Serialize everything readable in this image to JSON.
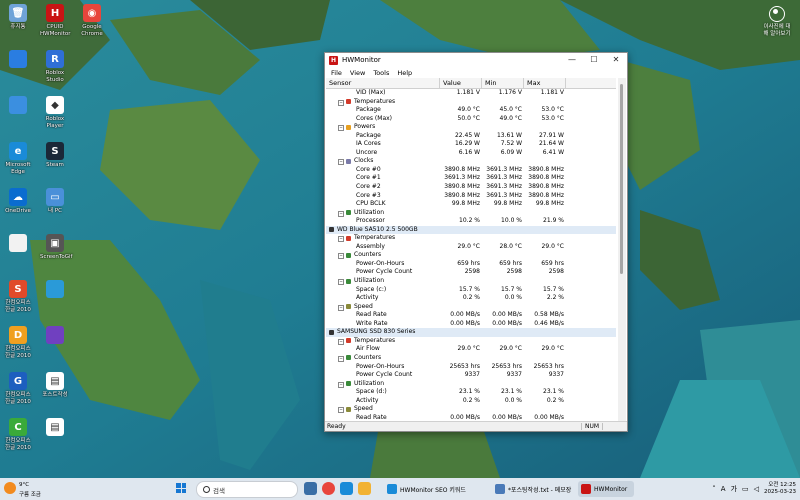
{
  "desktop": {
    "icons": [
      {
        "label": "휴지통",
        "color": "#6fa3d8",
        "glyph": "🗑"
      },
      {
        "label": "CPUID HWMonitor",
        "color": "#c91414",
        "glyph": "H"
      },
      {
        "label": "Google Chrome",
        "color": "#e8453c",
        "glyph": "◉"
      },
      {
        "label": "",
        "color": "#2a7de1",
        "glyph": ""
      },
      {
        "label": "Roblox Studio",
        "color": "#2f6fd6",
        "glyph": "R"
      },
      {
        "label": "",
        "color": "#3b8fe0",
        "glyph": ""
      },
      {
        "label": "Roblox Player",
        "color": "#ffffff",
        "glyph": "◆"
      },
      {
        "label": "Microsoft Edge",
        "color": "#1a8bd8",
        "glyph": "e"
      },
      {
        "label": "Steam",
        "color": "#1b2838",
        "glyph": "S"
      },
      {
        "label": "OneDrive",
        "color": "#0a6ccf",
        "glyph": "☁"
      },
      {
        "label": "내 PC",
        "color": "#4a90d9",
        "glyph": "▭"
      },
      {
        "label": "",
        "color": "#f2f2f2",
        "glyph": ""
      },
      {
        "label": "ScreenToGif",
        "color": "#555555",
        "glyph": "▣"
      },
      {
        "label": "한컴오피스 한글 2010",
        "color": "#e04a2a",
        "glyph": "S"
      },
      {
        "label": "",
        "color": "#2a9ad8",
        "glyph": ""
      },
      {
        "label": "한컴오피스 한글 2010",
        "color": "#f0a020",
        "glyph": "D"
      },
      {
        "label": "",
        "color": "#7040c0",
        "glyph": ""
      },
      {
        "label": "한컴오피스 한글 2010",
        "color": "#1d5fbf",
        "glyph": "G"
      },
      {
        "label": "포스트작성",
        "color": "#ffffff",
        "glyph": "▤"
      },
      {
        "label": "한컴오피스 한글 2010",
        "color": "#3aaa3a",
        "glyph": "C"
      },
      {
        "label": "",
        "color": "#ffffff",
        "glyph": "▤"
      }
    ],
    "corner_label": "이사진에 대해 알아보기"
  },
  "window": {
    "title": "HWMonitor",
    "menu": [
      "File",
      "View",
      "Tools",
      "Help"
    ],
    "columns": [
      "Sensor",
      "Value",
      "Min",
      "Max"
    ],
    "status": "Ready",
    "status_num": "NUM"
  },
  "rows": [
    {
      "indent": 2,
      "label": "VID (Max)",
      "value": "1.181 V",
      "min": "1.176 V",
      "max": "1.181 V"
    },
    {
      "indent": 1,
      "label": "Temperatures",
      "icon": "temperature-icon"
    },
    {
      "indent": 2,
      "label": "Package",
      "value": "49.0 °C",
      "min": "45.0 °C",
      "max": "53.0 °C"
    },
    {
      "indent": 2,
      "label": "Cores (Max)",
      "value": "50.0 °C",
      "min": "49.0 °C",
      "max": "53.0 °C"
    },
    {
      "indent": 1,
      "label": "Powers",
      "icon": "power-icon"
    },
    {
      "indent": 2,
      "label": "Package",
      "value": "22.45 W",
      "min": "13.61 W",
      "max": "27.91 W"
    },
    {
      "indent": 2,
      "label": "IA Cores",
      "value": "16.29 W",
      "min": "7.52 W",
      "max": "21.64 W"
    },
    {
      "indent": 2,
      "label": "Uncore",
      "value": "6.16 W",
      "min": "6.09 W",
      "max": "6.41 W"
    },
    {
      "indent": 1,
      "label": "Clocks",
      "icon": "clock-icon"
    },
    {
      "indent": 2,
      "label": "Core #0",
      "value": "3890.8 MHz",
      "min": "3691.3 MHz",
      "max": "3890.8 MHz"
    },
    {
      "indent": 2,
      "label": "Core #1",
      "value": "3691.3 MHz",
      "min": "3691.3 MHz",
      "max": "3890.8 MHz"
    },
    {
      "indent": 2,
      "label": "Core #2",
      "value": "3890.8 MHz",
      "min": "3691.3 MHz",
      "max": "3890.8 MHz"
    },
    {
      "indent": 2,
      "label": "Core #3",
      "value": "3890.8 MHz",
      "min": "3691.3 MHz",
      "max": "3890.8 MHz"
    },
    {
      "indent": 2,
      "label": "CPU BCLK",
      "value": "99.8 MHz",
      "min": "99.8 MHz",
      "max": "99.8 MHz"
    },
    {
      "indent": 1,
      "label": "Utilization",
      "icon": "utilization-icon"
    },
    {
      "indent": 2,
      "label": "Processor",
      "value": "10.2 %",
      "min": "10.0 %",
      "max": "21.9 %"
    },
    {
      "indent": 0,
      "label": "WD Blue SA510 2.5 500GB",
      "device": true
    },
    {
      "indent": 1,
      "label": "Temperatures",
      "icon": "temperature-icon"
    },
    {
      "indent": 2,
      "label": "Assembly",
      "value": "29.0 °C",
      "min": "28.0 °C",
      "max": "29.0 °C"
    },
    {
      "indent": 1,
      "label": "Counters",
      "icon": "counter-icon"
    },
    {
      "indent": 2,
      "label": "Power-On-Hours",
      "value": "659 hrs",
      "min": "659 hrs",
      "max": "659 hrs"
    },
    {
      "indent": 2,
      "label": "Power Cycle Count",
      "value": "2598",
      "min": "2598",
      "max": "2598"
    },
    {
      "indent": 1,
      "label": "Utilization",
      "icon": "utilization-icon"
    },
    {
      "indent": 2,
      "label": "Space (c:)",
      "value": "15.7 %",
      "min": "15.7 %",
      "max": "15.7 %"
    },
    {
      "indent": 2,
      "label": "Activity",
      "value": "0.2 %",
      "min": "0.0 %",
      "max": "2.2 %"
    },
    {
      "indent": 1,
      "label": "Speed",
      "icon": "speed-icon"
    },
    {
      "indent": 2,
      "label": "Read Rate",
      "value": "0.00 MB/s",
      "min": "0.00 MB/s",
      "max": "0.58 MB/s"
    },
    {
      "indent": 2,
      "label": "Write Rate",
      "value": "0.00 MB/s",
      "min": "0.00 MB/s",
      "max": "0.46 MB/s"
    },
    {
      "indent": 0,
      "label": "SAMSUNG SSD 830 Series",
      "device": true
    },
    {
      "indent": 1,
      "label": "Temperatures",
      "icon": "temperature-icon"
    },
    {
      "indent": 2,
      "label": "Air Flow",
      "value": "29.0 °C",
      "min": "29.0 °C",
      "max": "29.0 °C"
    },
    {
      "indent": 1,
      "label": "Counters",
      "icon": "counter-icon"
    },
    {
      "indent": 2,
      "label": "Power-On-Hours",
      "value": "25653 hrs",
      "min": "25653 hrs",
      "max": "25653 hrs"
    },
    {
      "indent": 2,
      "label": "Power Cycle Count",
      "value": "9337",
      "min": "9337",
      "max": "9337"
    },
    {
      "indent": 1,
      "label": "Utilization",
      "icon": "utilization-icon"
    },
    {
      "indent": 2,
      "label": "Space (d:)",
      "value": "23.1 %",
      "min": "23.1 %",
      "max": "23.1 %"
    },
    {
      "indent": 2,
      "label": "Activity",
      "value": "0.2 %",
      "min": "0.0 %",
      "max": "0.2 %"
    },
    {
      "indent": 1,
      "label": "Speed",
      "icon": "speed-icon"
    },
    {
      "indent": 2,
      "label": "Read Rate",
      "value": "0.00 MB/s",
      "min": "0.00 MB/s",
      "max": "0.00 MB/s"
    }
  ],
  "taskbar": {
    "weather_temp": "9°C",
    "weather_desc": "구름 조금",
    "search_placeholder": "검색",
    "tasks": [
      {
        "label": "HWMonitor SEO 키워드",
        "color": "#1a8bd8"
      },
      {
        "label": "*포스팅작성.txt - 메모장",
        "color": "#4a7ab8"
      },
      {
        "label": "HWMonitor",
        "color": "#c91414"
      }
    ],
    "tray_ime": "A",
    "tray_lang": "가",
    "clock_time": "오전 12:25",
    "clock_date": "2025-03-23"
  }
}
